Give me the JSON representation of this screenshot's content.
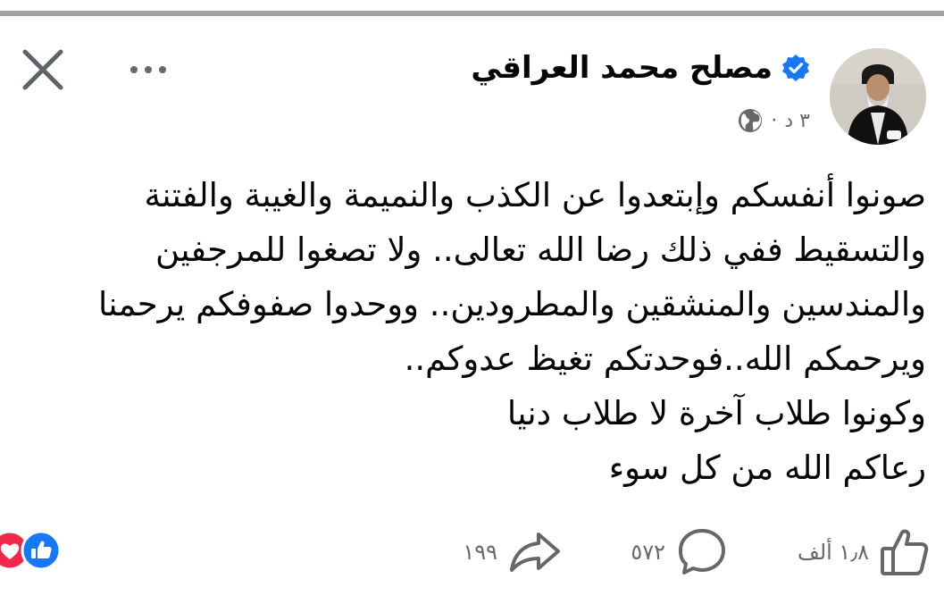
{
  "post": {
    "author_name": "مصلح محمد العراقي",
    "time_label": "٣ د",
    "separator": "·",
    "body_lines": [
      "صونوا أنفسكم وإبتعدوا عن الكذب والنميمة والغيبة والفتنة",
      "والتسقيط ففي ذلك رضا الله تعالى.. ولا تصغوا للمرجفين",
      "والمندسين والمنشقين والمطرودين.. ووحدوا صفوفكم يرحمنا",
      "ويرحمكم الله..فوحدتكم تغيظ عدوكم..",
      "وكونوا طلاب آخرة لا طلاب دنيا",
      "رعاكم الله من كل سوء"
    ]
  },
  "stats": {
    "likes_count": "١٫٨ ألف",
    "comments_count": "٥٧٢",
    "shares_count": "١٩٩"
  },
  "colors": {
    "verified_blue": "#1877f2",
    "like_blue": "#1877f2",
    "love_red": "#f02849",
    "muted_gray": "#65676b"
  },
  "icons": [
    "close-icon",
    "more-icon",
    "verified-icon",
    "globe-icon",
    "like-icon",
    "comment-icon",
    "share-icon",
    "like-reaction-icon",
    "love-reaction-icon"
  ]
}
